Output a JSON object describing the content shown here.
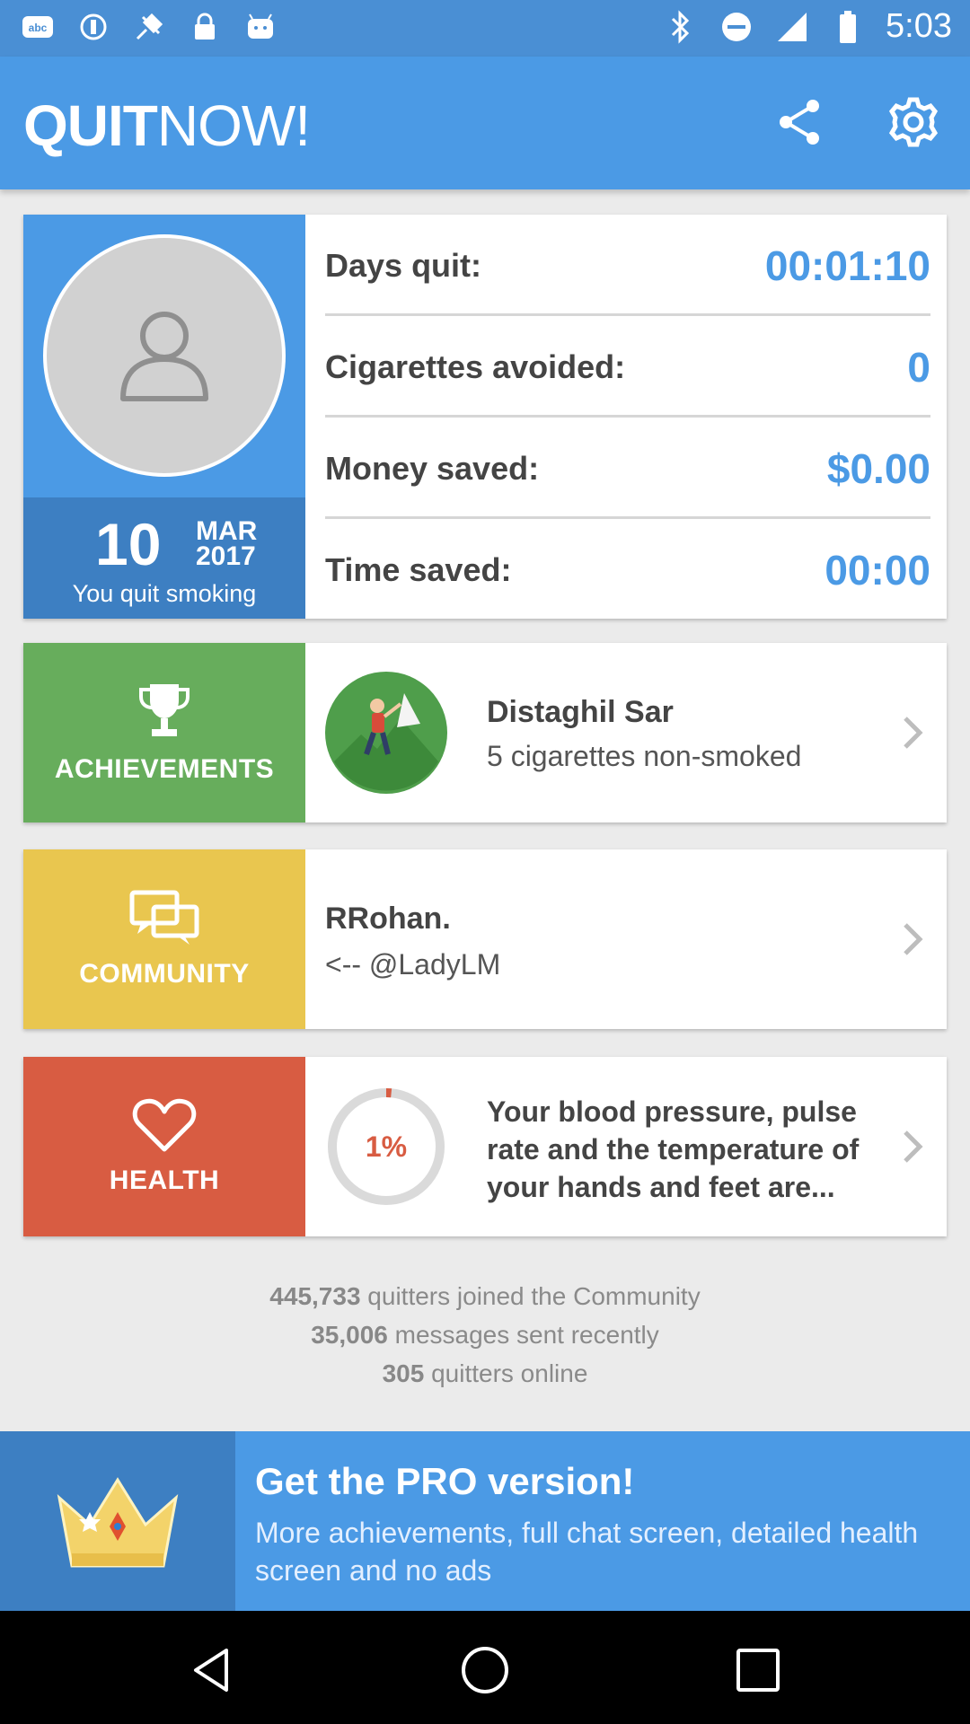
{
  "status_bar": {
    "time": "5:03",
    "icons": [
      "abc-app-icon",
      "hotspot-icon",
      "fake-gps-icon",
      "lock-icon",
      "android-icon"
    ],
    "right_icons": [
      "bluetooth-icon",
      "do-not-disturb-icon",
      "signal-icon",
      "battery-icon"
    ]
  },
  "app_bar": {
    "logo_bold": "QUIT",
    "logo_thin": "NOW!",
    "actions": [
      "share-icon",
      "settings-icon"
    ]
  },
  "profile": {
    "quit_day": "10",
    "quit_month": "MAR",
    "quit_year": "2017",
    "quit_caption": "You quit smoking",
    "stats": [
      {
        "label": "Days quit:",
        "value": "00:01:10"
      },
      {
        "label": "Cigarettes avoided:",
        "value": "0"
      },
      {
        "label": "Money saved:",
        "value": "$0.00"
      },
      {
        "label": "Time saved:",
        "value": "00:00"
      }
    ]
  },
  "achievements": {
    "side_label": "ACHIEVEMENTS",
    "title": "Distaghil Sar",
    "subtitle": "5 cigarettes non-smoked"
  },
  "community": {
    "side_label": "COMMUNITY",
    "title": "RRohan.",
    "subtitle": "<-- @LadyLM"
  },
  "health": {
    "side_label": "HEALTH",
    "progress_label": "1%",
    "progress_fraction": 0.01,
    "title": "Your blood pressure, pulse rate and the temperature of your hands and feet are..."
  },
  "community_stats": {
    "quitters": "445,733",
    "quitters_text": " quitters joined the Community",
    "messages": "35,006",
    "messages_text": " messages sent recently",
    "online": "305",
    "online_text": " quitters online"
  },
  "pro": {
    "title": "Get the PRO version!",
    "description": "More achievements, full chat screen, detailed health screen and no ads"
  },
  "colors": {
    "primary": "#4b9ae5",
    "primary_dark": "#3d7fc2",
    "achievements": "#67ad5c",
    "community": "#e9c64f",
    "health": "#d85c42"
  }
}
